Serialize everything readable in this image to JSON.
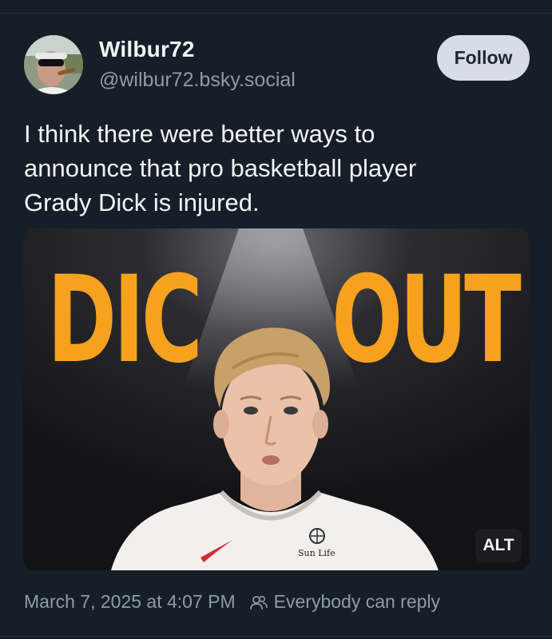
{
  "author": {
    "display_name": "Wilbur72",
    "handle": "@wilbur72.bsky.social"
  },
  "follow_button": {
    "label": "Follow"
  },
  "post": {
    "text_lines": [
      "I think there were better ways to",
      "announce that pro basketball player",
      "Grady Dick is injured."
    ]
  },
  "image": {
    "headline_left": "DIC",
    "headline_right": "OUT",
    "jersey_sponsor": "Sun Life",
    "alt_badge": "ALT",
    "accent_color": "#f6a21f"
  },
  "meta": {
    "timestamp": "March 7, 2025 at 4:07 PM",
    "reply_setting": "Everybody can reply",
    "reply_icon": "people-icon"
  },
  "colors": {
    "background": "#161e27",
    "muted_text": "#8d9bab",
    "follow_bg": "#d6dde6"
  }
}
